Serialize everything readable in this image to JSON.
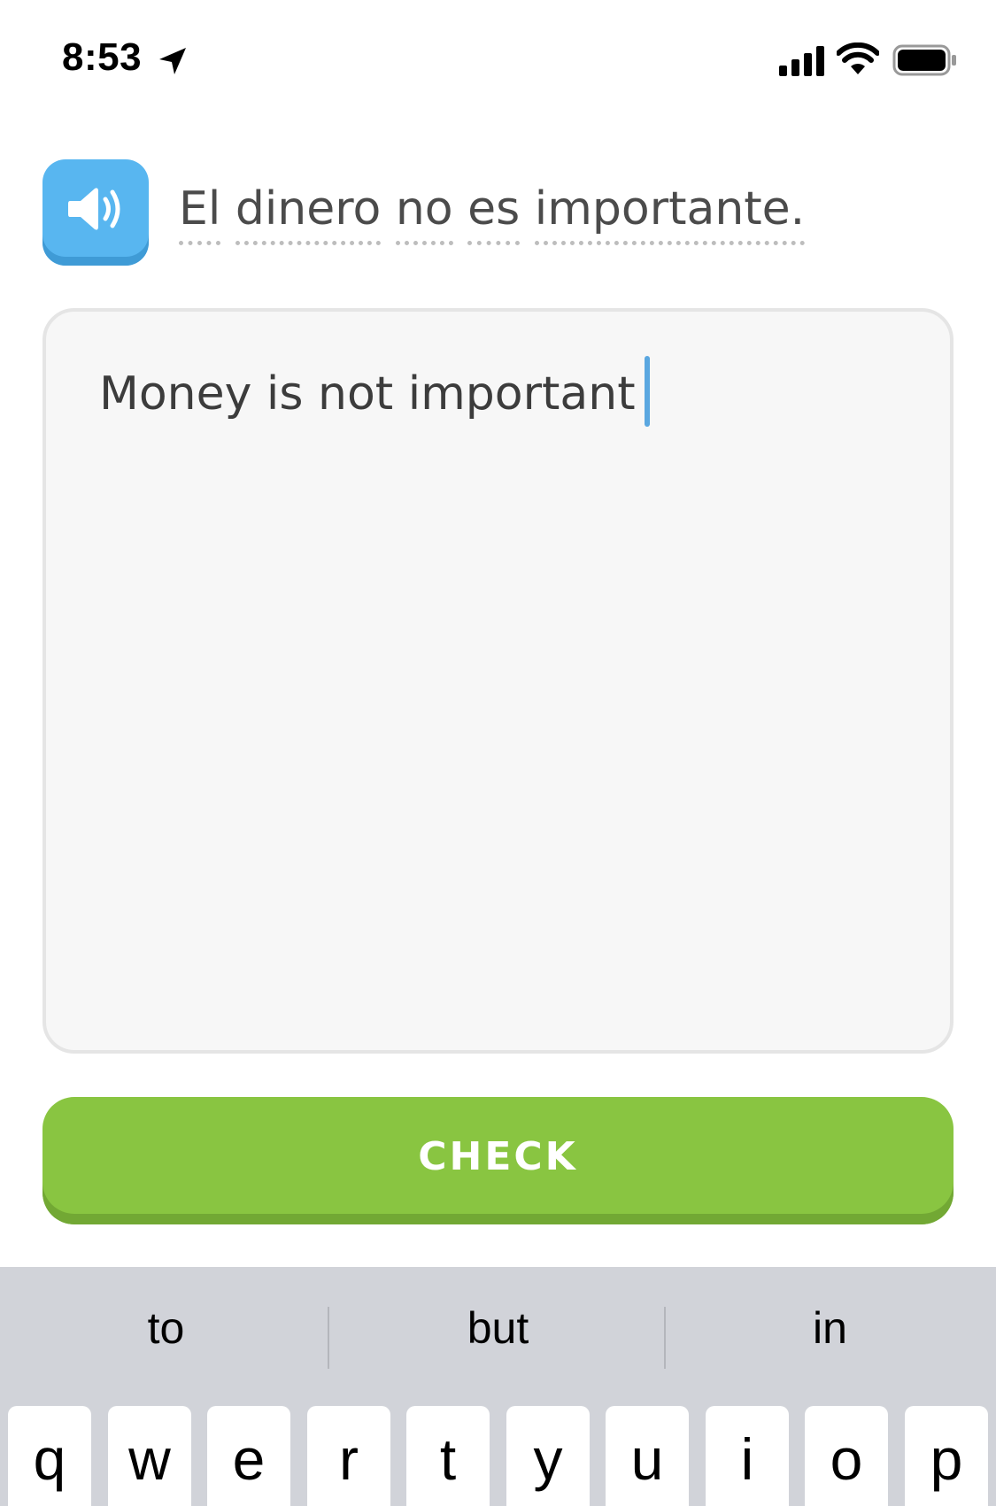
{
  "status_bar": {
    "time": "8:53",
    "icons": [
      "location-arrow-icon",
      "cellular-signal-icon",
      "wifi-icon",
      "battery-icon"
    ]
  },
  "prompt": {
    "speaker_icon": "speaker-icon",
    "words": [
      "El",
      "dinero",
      "no",
      "es",
      "importante."
    ]
  },
  "answer": {
    "value": "Money is not important"
  },
  "check_button": {
    "label": "CHECK"
  },
  "keyboard": {
    "suggestions": [
      "to",
      "but",
      "in"
    ],
    "top_row": [
      "q",
      "w",
      "e",
      "r",
      "t",
      "y",
      "u",
      "i",
      "o",
      "p"
    ]
  },
  "colors": {
    "speaker_blue": "#58b6f0",
    "check_green": "#89c541",
    "caret_blue": "#5aa7e0",
    "keyboard_bg": "#d1d3d9"
  }
}
